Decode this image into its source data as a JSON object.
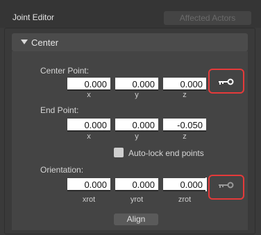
{
  "header": {
    "title": "Joint Editor",
    "affected_actors": "Affected Actors"
  },
  "section": {
    "label": "Center"
  },
  "center_point": {
    "label": "Center Point:",
    "x": "0.000",
    "y": "0.000",
    "z": "0.000",
    "x_label": "x",
    "y_label": "y",
    "z_label": "z"
  },
  "end_point": {
    "label": "End Point:",
    "x": "0.000",
    "y": "0.000",
    "z": "-0.050",
    "x_label": "x",
    "y_label": "y",
    "z_label": "z"
  },
  "auto_lock": {
    "label": "Auto-lock end points",
    "checked": false
  },
  "orientation": {
    "label": "Orientation:",
    "xrot": "0.000",
    "yrot": "0.000",
    "zrot": "0.000",
    "xrot_label": "xrot",
    "yrot_label": "yrot",
    "zrot_label": "zrot"
  },
  "align_label": "Align",
  "icons": {
    "center_key": "key-icon",
    "orientation_key": "key-icon"
  },
  "colors": {
    "highlight": "#e53a3a"
  }
}
